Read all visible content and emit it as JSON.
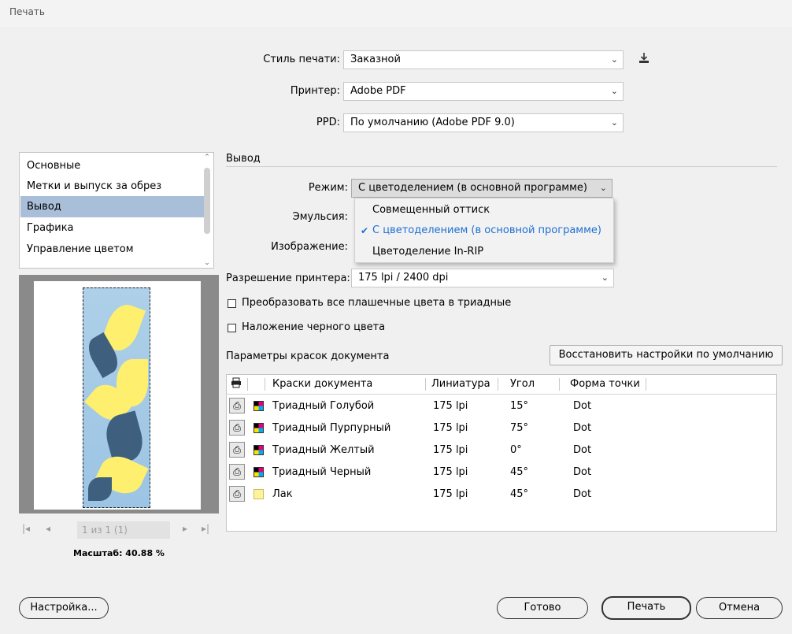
{
  "window": {
    "title": "Печать"
  },
  "top": {
    "print_style_label": "Стиль печати:",
    "print_style_value": "Заказной",
    "printer_label": "Принтер:",
    "printer_value": "Adobe PDF",
    "ppd_label": "PPD:",
    "ppd_value": "По умолчанию (Adobe PDF 9.0)"
  },
  "sidebar": {
    "items": [
      {
        "label": "Основные"
      },
      {
        "label": "Метки и выпуск за обрез"
      },
      {
        "label": "Вывод",
        "selected": true
      },
      {
        "label": "Графика"
      },
      {
        "label": "Управление цветом"
      }
    ]
  },
  "preview": {
    "page_indicator": "1 из 1 (1)",
    "zoom_label": "Масштаб: 40.88 %"
  },
  "output": {
    "section_title": "Вывод",
    "mode_label": "Режим:",
    "mode_value": "С цветоделением (в основной программе)",
    "mode_options": [
      {
        "label": "Совмещенный оттиск",
        "selected": false
      },
      {
        "label": "С цветоделением (в основной программе)",
        "selected": true
      },
      {
        "label": "Цветоделение In-RIP",
        "selected": false
      }
    ],
    "emulsion_label": "Эмульсия:",
    "image_label": "Изображение:",
    "resolution_label": "Разрешение принтера:",
    "resolution_value": "175 lpi / 2400 dpi",
    "convert_spot_label": "Преобразовать все плашечные цвета в триадные",
    "convert_spot_checked": false,
    "overprint_black_label": "Наложение черного цвета",
    "overprint_black_checked": false,
    "inks_title": "Параметры красок документа",
    "reset_button": "Восстановить настройки по умолчанию"
  },
  "ink_table": {
    "headers": {
      "inks": "Краски документа",
      "frequency": "Линиатура",
      "angle": "Угол",
      "dot_shape": "Форма точки"
    },
    "rows": [
      {
        "name": "Триадный Голубой",
        "swatch": "process",
        "frequency": "175 lpi",
        "angle": "15°",
        "dot": "Dot"
      },
      {
        "name": "Триадный Пурпурный",
        "swatch": "process",
        "frequency": "175 lpi",
        "angle": "75°",
        "dot": "Dot"
      },
      {
        "name": "Триадный Желтый",
        "swatch": "process",
        "frequency": "175 lpi",
        "angle": "0°",
        "dot": "Dot"
      },
      {
        "name": "Триадный Черный",
        "swatch": "process",
        "frequency": "175 lpi",
        "angle": "45°",
        "dot": "Dot"
      },
      {
        "name": "Лак",
        "swatch": "varnish",
        "frequency": "175 lpi",
        "angle": "45°",
        "dot": "Dot"
      }
    ]
  },
  "buttons": {
    "setup": "Настройка...",
    "done": "Готово",
    "print": "Печать",
    "cancel": "Отмена"
  },
  "icons": {
    "save_style": "download-icon",
    "printer": "printer-icon",
    "select_chevron": "chevron-down-icon",
    "nav_first": "first-page-icon",
    "nav_prev": "prev-page-icon",
    "nav_next": "next-page-icon",
    "nav_last": "last-page-icon"
  },
  "colors": {
    "selection": "#a9bfd9",
    "accent": "#1f6fd1",
    "varnish": "#fff39a"
  }
}
